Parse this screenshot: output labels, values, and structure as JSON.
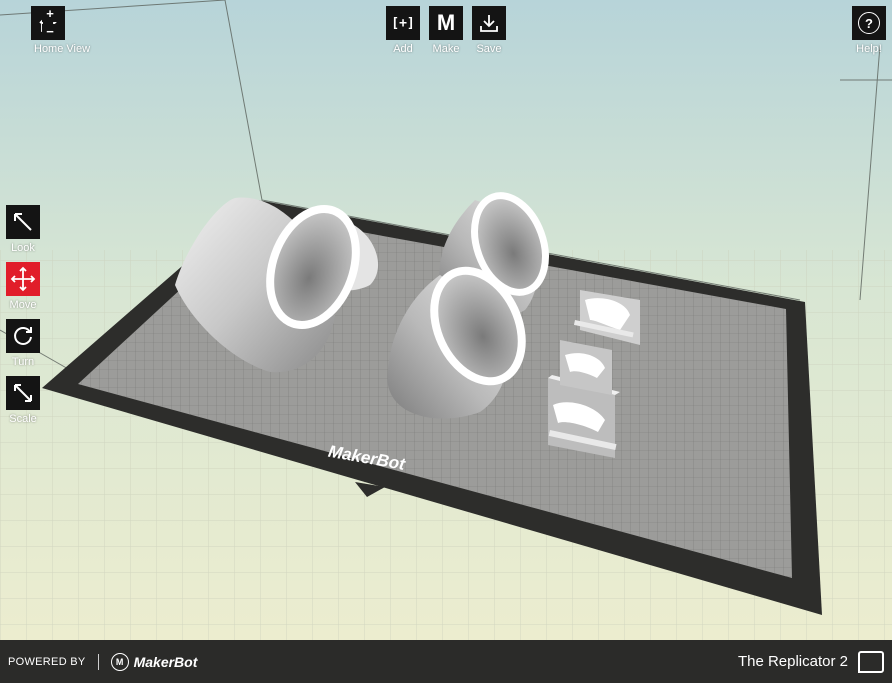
{
  "toolbar": {
    "home_label": "Home View",
    "zoom_in": "+",
    "zoom_out": "−",
    "add_label": "Add",
    "add_icon": "[+]",
    "make_label": "Make",
    "make_icon": "M",
    "save_label": "Save",
    "help_label": "Help!",
    "help_icon": "?"
  },
  "side_tools": [
    {
      "label": "Look",
      "icon": "look-arrow-icon"
    },
    {
      "label": "Move",
      "icon": "move-cross-icon",
      "active": true
    },
    {
      "label": "Turn",
      "icon": "turn-circle-icon"
    },
    {
      "label": "Scale",
      "icon": "scale-arrow-icon"
    }
  ],
  "build_plate": {
    "brand": "MakerBot"
  },
  "footer": {
    "powered_by": "POWERED BY",
    "brand": "MakerBot",
    "printer": "The Replicator 2"
  },
  "colors": {
    "active_tool": "#e11d2a",
    "toolbar_button": "#141414",
    "footer": "#2b2b29"
  }
}
